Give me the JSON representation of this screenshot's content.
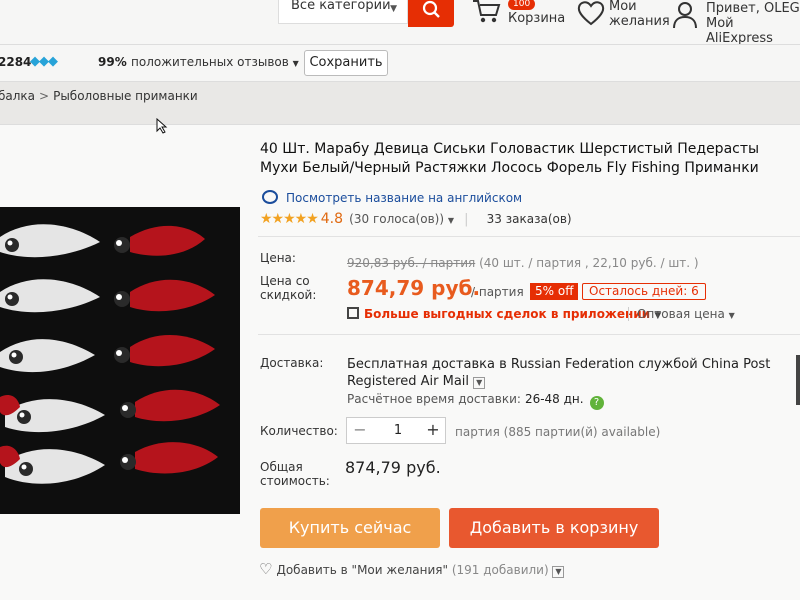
{
  "header": {
    "category_select": "Все категории",
    "cart_count": "100",
    "cart_label": "Корзина",
    "wishlist_line1": "Мои",
    "wishlist_line2": "желания",
    "account_line1": "Привет, OLEG",
    "account_line2": "Мой AliExpress",
    "accent_color": "#e62e04"
  },
  "store": {
    "rating_count": "2284",
    "feedback_percent": "99%",
    "feedback_label": "положительных отзывов",
    "save_label": "Сохранить"
  },
  "breadcrumb": [
    "балка",
    "Рыболовные приманки"
  ],
  "product": {
    "title": "40 Шт. Марабу Девица Сиськи Головастик Шерстистый Педерасты Мухи Белый/Черный Растяжки Лосось Форель Fly Fishing Приманки",
    "translate_link": "Посмотреть название на английском",
    "stars": "★★★★★",
    "rating": "4.8",
    "votes": "(30 голоса(ов))",
    "orders": "33 заказа(ов)"
  },
  "pricing": {
    "price_label": "Цена:",
    "old_price": "920,83 руб. / партия",
    "lot_info": "(40 шт. / партия , 22,10 руб. / шт. )",
    "discount_label_1": "Цена со",
    "discount_label_2": "скидкой:",
    "new_price": "874,79 руб.",
    "per_lot": "/ партия",
    "discount_badge": "5% off",
    "days_left": "Осталось дней: 6",
    "app_deals": "Больше выгодных сделок в приложении",
    "wholesale": "Оптовая цена"
  },
  "shipping": {
    "label": "Доставка:",
    "text": "Бесплатная доставка в Russian Federation службой China Post Registered Air Mail",
    "estimate_label": "Расчётное время доставки:",
    "estimate_days": "26-48 дн."
  },
  "quantity": {
    "label": "Количество:",
    "minus": "−",
    "value": "1",
    "plus": "+",
    "note": "партия (885 партии(й) available)"
  },
  "total": {
    "label_1": "Общая",
    "label_2": "стоимость:",
    "value": "874,79 руб."
  },
  "actions": {
    "buy_now": "Купить сейчас",
    "add_to_cart": "Добавить в корзину",
    "wishlist_add": "Добавить в \"Мои желания\"",
    "wishlist_count": "(191 добавили)"
  }
}
